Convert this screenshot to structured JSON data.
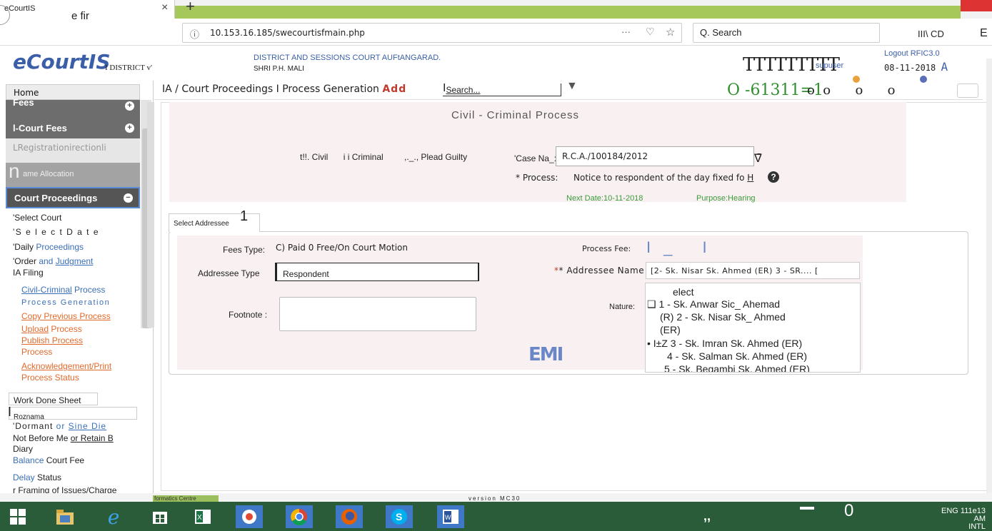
{
  "browser": {
    "tab_title": "eCourtIS",
    "tab_close": "×",
    "new_tab": "+",
    "find_text": "e fir",
    "url": "10.153.16.185/swecourtisfmain.php",
    "url_more": "···",
    "search_placeholder": "Q. Search",
    "library": "III\\ CD",
    "menu": "E"
  },
  "header": {
    "logo": "eCourtIS",
    "district": "I DISTRICT v'",
    "court_name": "DISTRICT AND SESSIONS COURT AUFtANGARAD.",
    "judge": "SHRI P.H. MALI",
    "user_glyph": "TTTTTTTTT",
    "user": "supuser",
    "logout": "Logout RFIC3.0",
    "date": "08-11-2018",
    "date_suffix": "A"
  },
  "sidebar": {
    "home": "Home",
    "fees": "Fees",
    "court_fees": "l-Court Fees",
    "registration": "LRegistrationirectionli",
    "allocation_n": "n",
    "allocation": "ame Allocation",
    "proceedings": "Court Proceedings",
    "links": [
      "'Select Court",
      "'S e l e c t  D a t e",
      "'Daily",
      "Proceedings",
      "'Order",
      "and",
      "Judgment",
      "IA Filing"
    ],
    "sub": {
      "civil": "Civil-Criminal",
      "process": "Process",
      "process_gen": "Process Generation",
      "copy": "Copy Previous Process",
      "upload": "Upload",
      "upload_process": "Process",
      "publish": "Publish Process",
      "process_word": "Process",
      "ack": "Acknowledgement/Print",
      "status": "Process Status"
    },
    "bottom": {
      "work_done": "Work Done Sheet",
      "roznama_i": "I",
      "roznama": "Roznama",
      "dormant": "'Dormant",
      "or": "or",
      "sine_die": "Sine Die",
      "not_before": "Not Before Me",
      "or_retain": "or Retain B",
      "diary": "Diary",
      "balance": "Balance",
      "court_fee": "Court Fee",
      "delay": "Delay",
      "status": "Status",
      "framing": "r Framing of Issues/Charge"
    }
  },
  "breadcrumb": {
    "path": "IA / Court Proceedings I Process Generation",
    "add": "Add",
    "search": "Search...",
    "search_i": "I",
    "status_glyphs": "O -61311=1",
    "dots": "o  o      o      o"
  },
  "process": {
    "title": "Civil - Criminal Process",
    "radio_civil": "t!!. Civil",
    "radio_criminal": "i i Criminal",
    "radio_plead": ",._., Plead Guilty",
    "case_label": "'Case Na_:",
    "case_value": "R.C.A./100184/2012",
    "case_glyph": "∇̄",
    "process_label": "* Process:",
    "process_value": "Notice to respondent of the day fixed fo",
    "process_h": "H",
    "help": "?",
    "next_date": "Next Date:10-11-2018",
    "purpose": "Purpose:Hearing"
  },
  "addressee": {
    "tab_label": "Select Addressee",
    "tab_one": "1",
    "fees_type_label": "Fees Type:",
    "fees_type_value": "C)  Paid 0 Free/On Court Motion",
    "process_fee_label": "Process Fee:",
    "process_fee_glyph": "I_ I",
    "addressee_type_label": "Addressee Type",
    "addressee_type_value": "Respondent",
    "addressee_name_label": "* Addressee Name :",
    "addressee_name_value": "[2- Sk. Nisar Sk. Ahmed (ER) 3 - SR.... [",
    "footnote_label": "Footnote :",
    "nature_label": "Nature:",
    "nature_items": [
      "elect",
      "❑ 1 - Sk. Anwar Sic_ Ahemad",
      "(R) 2 - Sk. Nisar Sk_ Ahmed",
      "(ER)",
      "• I±Z 3 - Sk. Imran Sk. Ahmed (ER)",
      "4 - Sk. Salman Sk. Ahmed (ER)",
      "5 - Sk. Begambi Sk. Ahmed (ER)"
    ],
    "emi": "EMI"
  },
  "footer": {
    "nic": "formatics Centre",
    "version": "version MC30"
  },
  "taskbar": {
    "quote": ",,",
    "zero": "0",
    "clock_line1": "ENG 111e13 AM",
    "clock_line2": "INTL 11/3/2013"
  },
  "colors": {
    "accent_blue": "#3a5fa8",
    "link_orange": "#e06a2c",
    "status_green": "#3a9a3a",
    "taskbar": "#2b5c3a",
    "sidebar_dark": "#6d6d6d"
  }
}
